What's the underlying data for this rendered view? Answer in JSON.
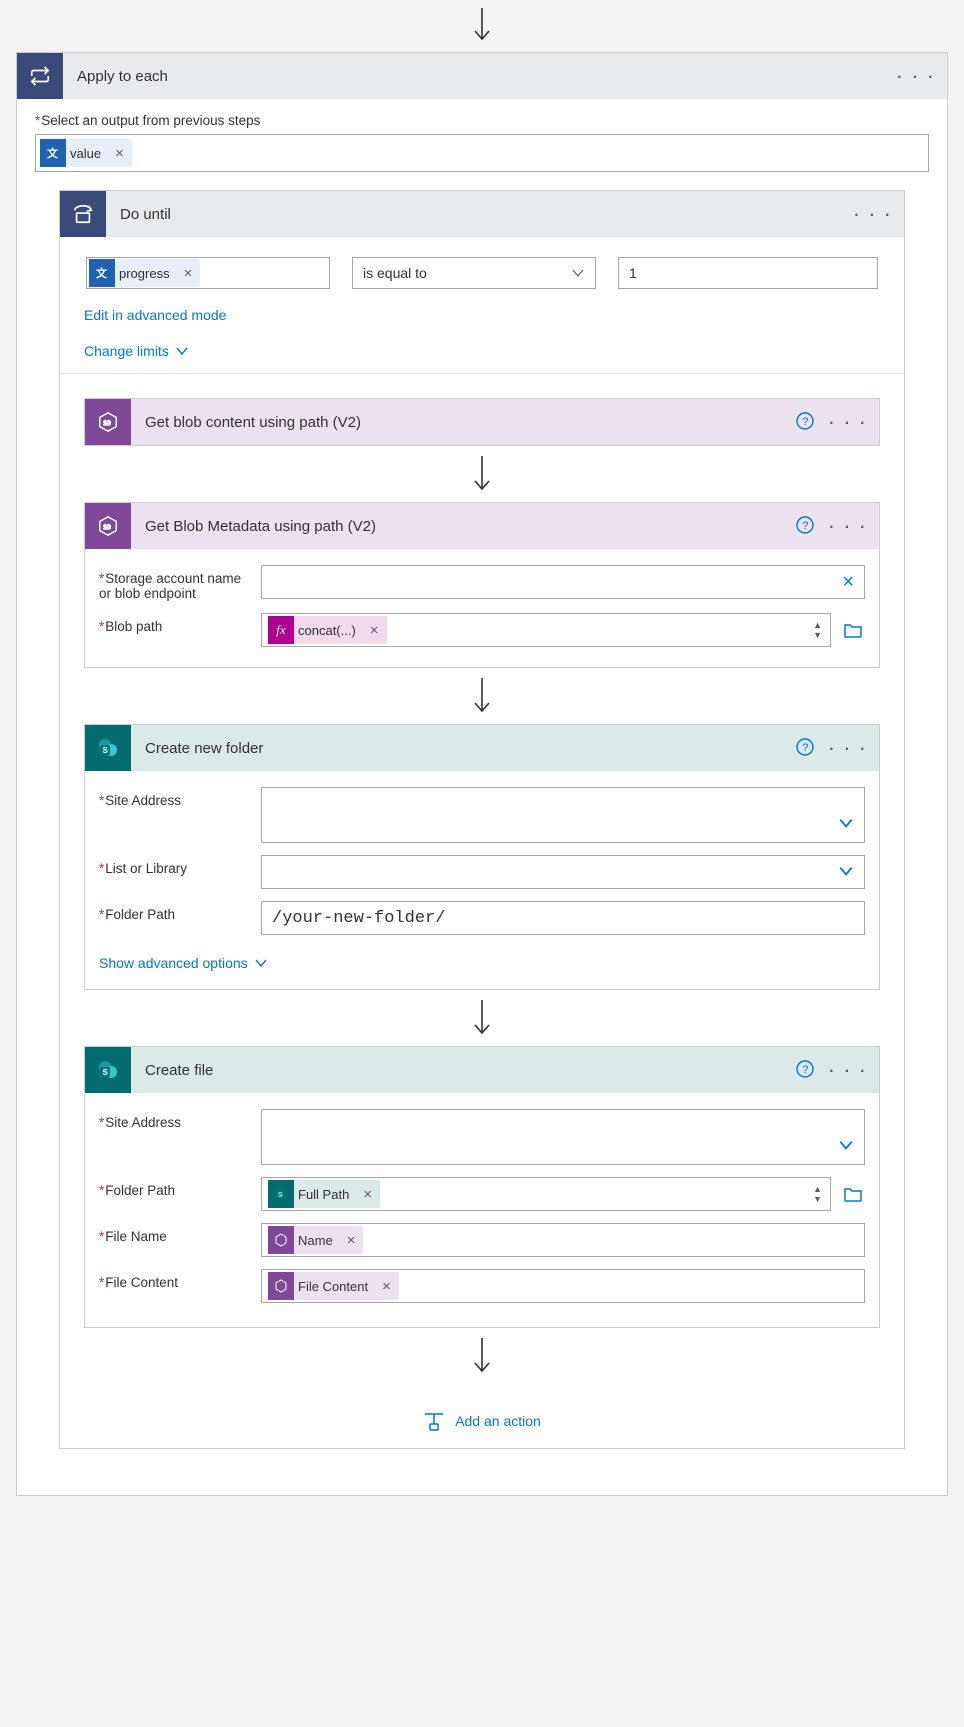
{
  "outer": {
    "title": "Apply to each",
    "select_label": "Select an output from previous steps",
    "value_token": "value"
  },
  "do_until": {
    "title": "Do until",
    "progress_token": "progress",
    "operator": "is equal to",
    "rhs": "1",
    "edit_adv": "Edit in advanced mode",
    "change_limits": "Change limits"
  },
  "blob1": {
    "title": "Get blob content using path (V2)"
  },
  "blob2": {
    "title": "Get Blob Metadata using path (V2)",
    "p1_label": "Storage account name or blob endpoint",
    "p2_label": "Blob path",
    "concat_token": "concat(...)"
  },
  "folder": {
    "title": "Create new folder",
    "p1": "Site Address",
    "p2": "List or Library",
    "p3": "Folder Path",
    "p3_val": "/your-new-folder/",
    "show_adv": "Show advanced options"
  },
  "file": {
    "title": "Create file",
    "p1": "Site Address",
    "p2": "Folder Path",
    "p2_token": "Full Path",
    "p3": "File Name",
    "p3_token": "Name",
    "p4": "File Content",
    "p4_token": "File Content"
  },
  "add_action": "Add an action"
}
